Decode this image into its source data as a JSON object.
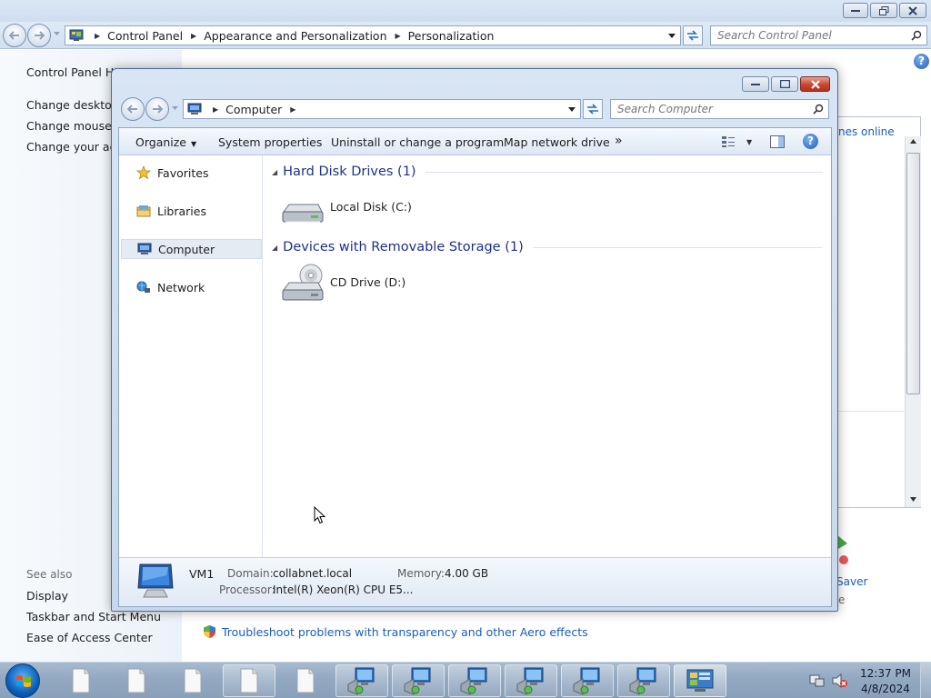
{
  "control_panel": {
    "breadcrumb": [
      "Control Panel",
      "Appearance and Personalization",
      "Personalization"
    ],
    "search_placeholder": "Search Control Panel",
    "left_links": [
      "Control Panel Home",
      "Change desktop icons",
      "Change mouse pointers",
      "Change your account picture"
    ],
    "see_also_label": "See also",
    "see_also_links": [
      "Display",
      "Taskbar and Start Menu",
      "Ease of Access Center"
    ],
    "main": {
      "partial_link": "nes online",
      "partial_item": "Saver",
      "partial_letter": "e",
      "troubleshoot_link": "Troubleshoot problems with transparency and other Aero effects"
    }
  },
  "explorer": {
    "address_path": "Computer",
    "search_placeholder": "Search Computer",
    "commands": [
      "Organize",
      "System properties",
      "Uninstall or change a program",
      "Map network drive"
    ],
    "more_commands": "»",
    "nav_items": [
      {
        "label": "Favorites",
        "icon": "star-icon"
      },
      {
        "label": "Libraries",
        "icon": "libraries-icon"
      },
      {
        "label": "Computer",
        "icon": "computer-icon",
        "selected": true
      },
      {
        "label": "Network",
        "icon": "network-icon"
      }
    ],
    "groups": [
      {
        "title": "Hard Disk Drives (1)",
        "items": [
          {
            "label": "Local Disk (C:)",
            "icon": "hard-disk-icon"
          }
        ]
      },
      {
        "title": "Devices with Removable Storage (1)",
        "items": [
          {
            "label": "CD Drive (D:)",
            "icon": "cd-drive-icon"
          }
        ]
      }
    ],
    "details": {
      "name": "VM1",
      "domain_label": "Domain:",
      "domain_value": "collabnet.local",
      "memory_label": "Memory:",
      "memory_value": "4.00 GB",
      "processor_label": "Processor:",
      "processor_value": "Intel(R) Xeon(R) CPU E5..."
    }
  },
  "taskbar": {
    "time": "12:37 PM",
    "date": "4/8/2024",
    "buttons": [
      "document-icon",
      "document-icon",
      "document-icon",
      "document-icon",
      "document-icon",
      "remote-desktop-icon",
      "remote-desktop-icon",
      "remote-desktop-icon",
      "remote-desktop-icon",
      "remote-desktop-icon",
      "remote-desktop-icon",
      "control-panel-icon"
    ]
  },
  "colors": {
    "group_header": "#1e3287",
    "link_blue": "#1a5fb4",
    "selection": "#e5ebf3"
  }
}
